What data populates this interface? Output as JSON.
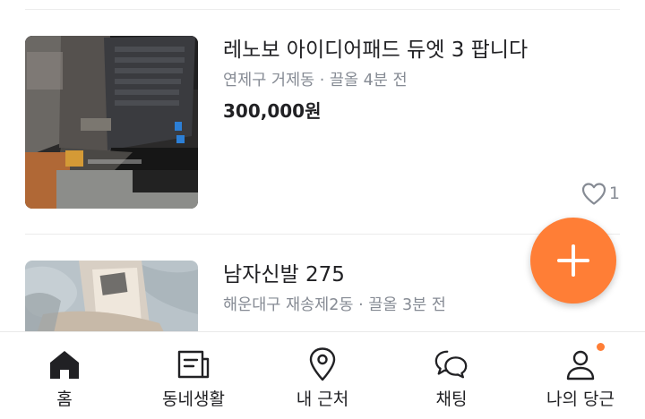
{
  "colors": {
    "accent": "#ff7e36",
    "text_primary": "#212124",
    "text_secondary": "#868b94",
    "divider": "#ececec"
  },
  "listings": [
    {
      "title": "레노보 아이디어패드 듀엣 3 팝니다",
      "location": "연제구 거제동",
      "time": "끌올 4분 전",
      "price": "300,000원",
      "likes": "1",
      "like_icon": "heart-outline-icon"
    },
    {
      "title": "남자신발 275",
      "location": "해운대구 재송제2동",
      "time": "끌올 3분 전"
    }
  ],
  "separator": "·",
  "fab": {
    "icon": "plus-icon"
  },
  "bottom_nav": {
    "items": [
      {
        "label": "홈",
        "icon": "home-icon",
        "active": true
      },
      {
        "label": "동네생활",
        "icon": "neighborhood-board-icon"
      },
      {
        "label": "내 근처",
        "icon": "location-pin-icon"
      },
      {
        "label": "채팅",
        "icon": "chat-bubbles-icon"
      },
      {
        "label": "나의 당근",
        "icon": "profile-icon",
        "badge": true
      }
    ]
  }
}
